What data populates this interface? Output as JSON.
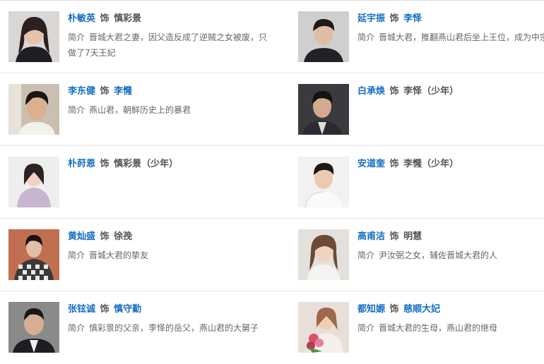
{
  "cast": [
    {
      "left": {
        "actor": "朴敏英",
        "as": "饰",
        "role": "慎彩景",
        "role_link": false,
        "intro_label": "简介",
        "intro": "晋城大君之妻，因父造反成了逆贼之女被废，只做了7天王妃",
        "photo": "portrait-photo"
      },
      "right": {
        "actor": "延宇振",
        "as": "饰",
        "role": "李怿",
        "role_link": true,
        "intro_label": "简介",
        "intro": "晋城大君，推翻燕山君后坐上王位，成为中宗",
        "photo": "portrait-photo"
      }
    },
    {
      "left": {
        "actor": "李东健",
        "as": "饰",
        "role": "李㦕",
        "role_link": true,
        "intro_label": "简介",
        "intro": "燕山君，朝鲜历史上的暴君",
        "photo": "portrait-photo"
      },
      "right": {
        "actor": "白承焕",
        "as": "饰",
        "role": "李怿（少年）",
        "role_link": false,
        "intro_label": "",
        "intro": "",
        "photo": "portrait-photo"
      }
    },
    {
      "left": {
        "actor": "朴莳恩",
        "as": "饰",
        "role": "慎彩景（少年）",
        "role_link": false,
        "intro_label": "",
        "intro": "",
        "photo": "portrait-photo"
      },
      "right": {
        "actor": "安道奎",
        "as": "饰",
        "role": "李㦕（少年）",
        "role_link": false,
        "intro_label": "",
        "intro": "",
        "photo": "portrait-photo"
      }
    },
    {
      "left": {
        "actor": "黄灿盛",
        "as": "饰",
        "role": "徐㝃",
        "role_link": false,
        "intro_label": "简介",
        "intro": "晋城大君的挚友",
        "photo": "portrait-photo"
      },
      "right": {
        "actor": "高甫洁",
        "as": "饰",
        "role": "明慧",
        "role_link": false,
        "intro_label": "简介",
        "intro": "尹汝弼之女，辅佐晋城大君的人",
        "photo": "portrait-photo"
      }
    },
    {
      "left": {
        "actor": "张铉诚",
        "as": "饰",
        "role": "慎守勤",
        "role_link": true,
        "intro_label": "简介",
        "intro": "慎彩景的父亲，李怿的岳父，燕山君的大舅子",
        "photo": "portrait-photo"
      },
      "right": {
        "actor": "都知嫄",
        "as": "饰",
        "role": "慈顺大妃",
        "role_link": true,
        "intro_label": "简介",
        "intro": "晋城大君的生母，燕山君的继母",
        "photo": "portrait-photo"
      }
    }
  ],
  "colors": {
    "link": "#136ec2",
    "text": "#555555",
    "muted": "#666666",
    "divider": "#e8e8e8"
  }
}
